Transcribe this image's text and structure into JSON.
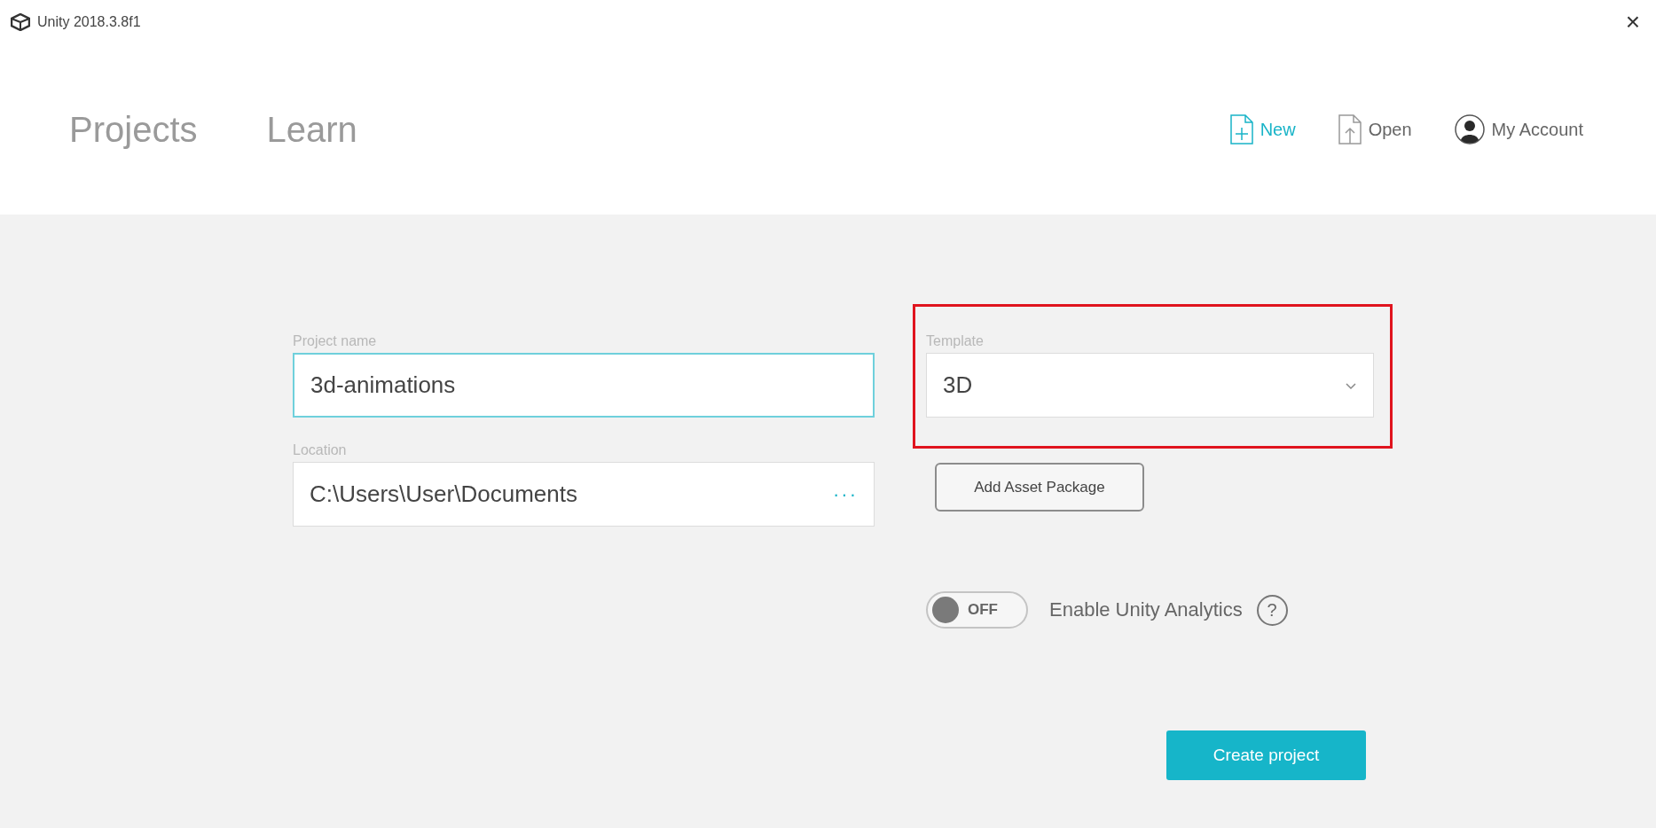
{
  "window": {
    "title": "Unity 2018.3.8f1",
    "close": "×"
  },
  "nav_tabs": [
    {
      "label": "Projects",
      "selected": false
    },
    {
      "label": "Learn",
      "selected": false
    }
  ],
  "actions": [
    {
      "label": "New",
      "kind": "new",
      "selected": true
    },
    {
      "label": "Open",
      "kind": "open",
      "selected": false
    },
    {
      "label": "My Account",
      "kind": "account",
      "selected": false
    }
  ],
  "form": {
    "project_name": {
      "label": "Project name",
      "value": "3d-animations"
    },
    "template": {
      "label": "Template",
      "value": "3D",
      "highlighted": true
    },
    "location": {
      "label": "Location",
      "value": "C:\\Users\\User\\Documents",
      "browse": "···"
    },
    "add_asset_button": "Add Asset Package",
    "analytics": {
      "on": false,
      "toggle_text": "OFF",
      "label": "Enable Unity Analytics",
      "help": "?"
    },
    "create_button": "Create project"
  }
}
